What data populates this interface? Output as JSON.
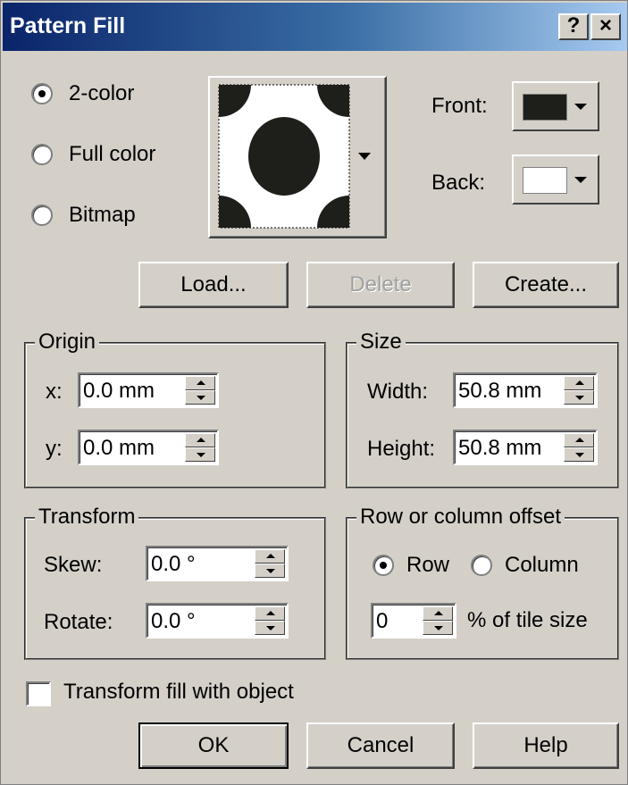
{
  "window": {
    "title": "Pattern Fill",
    "help_btn": "?",
    "close_btn": "×"
  },
  "fill_type": {
    "options": [
      "2-color",
      "Full color",
      "Bitmap"
    ],
    "selected": "2-color"
  },
  "colors": {
    "front_label": "Front:",
    "back_label": "Back:",
    "front_color": "#1e1e1a",
    "back_color": "#ffffff"
  },
  "buttons": {
    "load": "Load...",
    "delete": "Delete",
    "create": "Create...",
    "ok": "OK",
    "cancel": "Cancel",
    "help": "Help"
  },
  "origin": {
    "legend": "Origin",
    "x_label": "x:",
    "x_value": "0.0 mm",
    "y_label": "y:",
    "y_value": "0.0 mm"
  },
  "size": {
    "legend": "Size",
    "width_label": "Width:",
    "width_value": "50.8 mm",
    "height_label": "Height:",
    "height_value": "50.8 mm"
  },
  "transform": {
    "legend": "Transform",
    "skew_label": "Skew:",
    "skew_value": "0.0 °",
    "rotate_label": "Rotate:",
    "rotate_value": "0.0 °"
  },
  "offset": {
    "legend": "Row or column offset",
    "row_label": "Row",
    "column_label": "Column",
    "selected": "Row",
    "value": "0",
    "suffix": "% of tile size"
  },
  "transform_fill": {
    "label": "Transform fill with object",
    "checked": false
  }
}
